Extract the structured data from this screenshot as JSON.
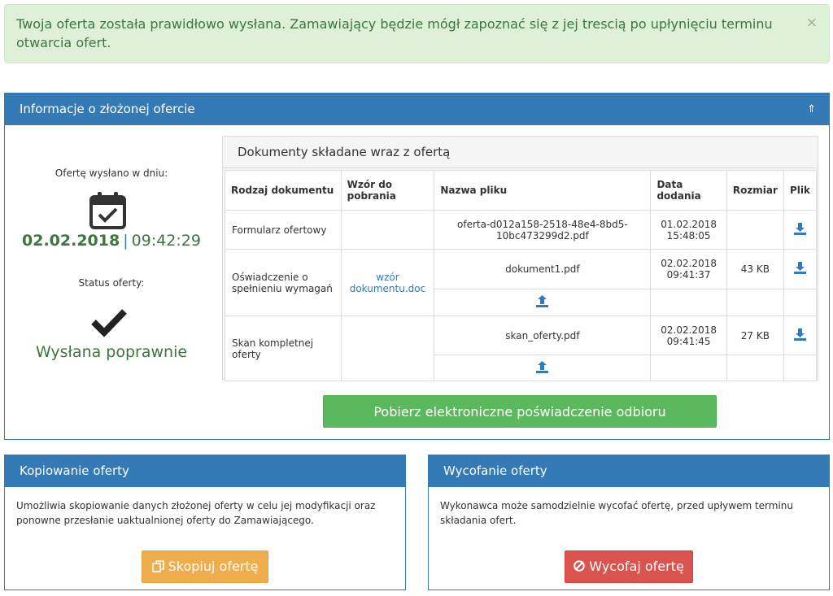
{
  "alert": {
    "message": "Twoja oferta została prawidłowo wysłana. Zamawiający będzie mógł zapoznać się z jej trescią po upłynięciu terminu otwarcia ofert.",
    "close": "×"
  },
  "main_panel": {
    "title": "Informacje o złożonej ofercie",
    "collapse_icon": "⇑",
    "sent_label": "Ofertę wysłano w dniu:",
    "sent_date": "02.02.2018",
    "sent_sep": "|",
    "sent_time": "09:42:29",
    "status_label": "Status oferty:",
    "status_value": "Wysłana poprawnie"
  },
  "documents": {
    "title": "Dokumenty składane wraz z ofertą",
    "headers": [
      "Rodzaj dokumentu",
      "Wzór do pobrania",
      "Nazwa pliku",
      "Data dodania",
      "Rozmiar",
      "Plik"
    ],
    "rows": [
      {
        "type": "Formularz ofertowy",
        "template": "",
        "file": "oferta-d012a158-2518-48e4-8bd5-10bc473299d2.pdf",
        "date": "01.02.2018",
        "time": "15:48:05",
        "size": ""
      },
      {
        "type": "Oświadczenie o spełnieniu wymagań",
        "template": "wzór dokumentu.doc",
        "file": "dokument1.pdf",
        "date": "02.02.2018",
        "time": "09:41:37",
        "size": "43 KB"
      },
      {
        "type": "Skan kompletnej oferty",
        "template": "",
        "file": "skan_oferty.pdf",
        "date": "02.02.2018",
        "time": "09:41:45",
        "size": "27 KB"
      }
    ],
    "download_icon": "download-icon",
    "upload_icon": "upload-icon"
  },
  "receipt_button": "Pobierz elektroniczne poświadczenie odbioru",
  "copy_panel": {
    "title": "Kopiowanie oferty",
    "text": "Umożliwia skopiowanie danych złożonej oferty w celu jej modyfikacji oraz ponowne przesłanie uaktualnionej oferty do Zamawiającego.",
    "button": "Skopiuj ofertę",
    "button_icon": "copy-icon"
  },
  "withdraw_panel": {
    "title": "Wycofanie oferty",
    "text": "Wykonawca może samodzielnie wycofać ofertę, przed upływem terminu składania ofert.",
    "button": "Wycofaj ofertę",
    "button_icon": "ban-icon"
  },
  "colors": {
    "primary": "#337ab7",
    "success": "#5cb85c",
    "warning": "#f0ad4e",
    "danger": "#d9534f",
    "alert_bg": "#dff0d8",
    "status_green": "#3c763d"
  }
}
